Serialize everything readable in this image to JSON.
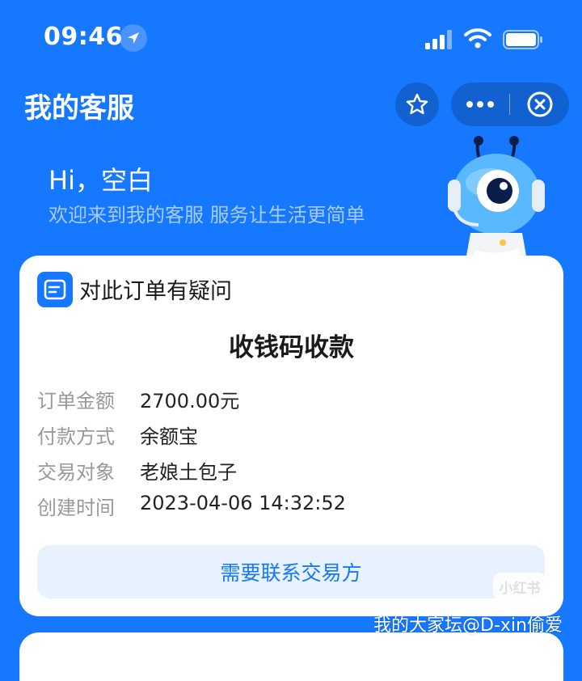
{
  "status_bar": {
    "time": "09:46",
    "icons": [
      "location-arrow-icon",
      "cellular-signal-icon",
      "wifi-icon",
      "battery-icon"
    ]
  },
  "nav": {
    "title": "我的客服",
    "buttons": [
      "star-icon",
      "more-icon",
      "close-icon"
    ]
  },
  "header": {
    "greeting": "Hi，空白",
    "welcome": "欢迎来到我的客服 服务让生活更简单"
  },
  "card": {
    "title": "对此订单有疑问",
    "order_title": "收钱码收款",
    "rows": [
      {
        "label": "订单金额",
        "value": "2700.00元"
      },
      {
        "label": "付款方式",
        "value": "余额宝"
      },
      {
        "label": "交易对象",
        "value": "老娘土包子"
      },
      {
        "label": "创建时间",
        "value": "2023-04-06 14:32:52"
      }
    ],
    "contact_button": "需要联系交易方"
  },
  "watermark": {
    "logo": "小红书",
    "text": "我的大家坛@D-xin偷爱"
  },
  "colors": {
    "brand_blue": "#1677ff",
    "button_bg": "#e8f2ff",
    "label_gray": "#999999"
  }
}
